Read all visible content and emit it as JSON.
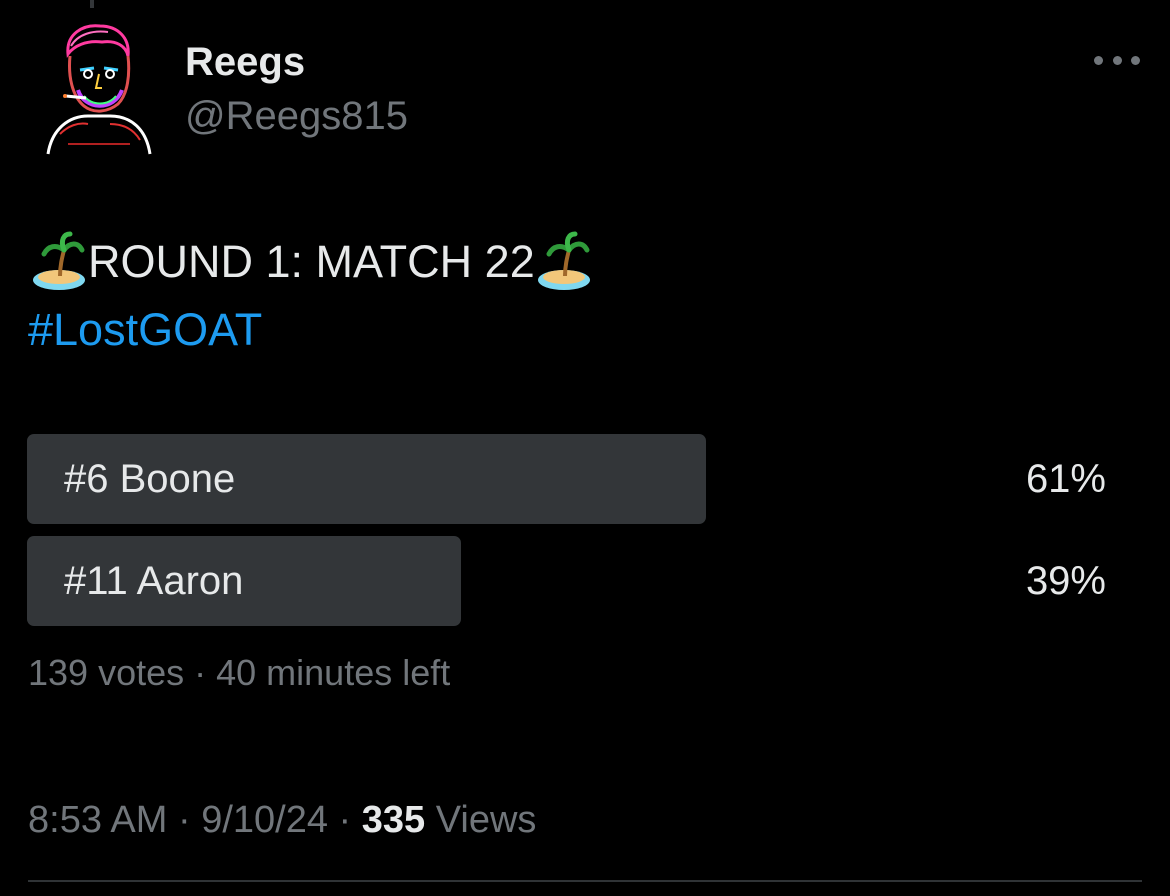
{
  "author": {
    "display_name": "Reegs",
    "handle": "@Reegs815",
    "avatar_icon": "neon-portrait-avatar"
  },
  "more_icon": "more-horizontal-icon",
  "tweet": {
    "title_text": "ROUND 1: MATCH 22",
    "leading_emoji": "desert-island-icon",
    "trailing_emoji": "desert-island-icon",
    "hashtag": "#LostGOAT"
  },
  "poll": {
    "options": [
      {
        "label": "#6 Boone",
        "percent_text": "61%",
        "fraction": 0.61
      },
      {
        "label": "#11 Aaron",
        "percent_text": "39%",
        "fraction": 0.39
      }
    ],
    "votes": "139 votes",
    "separator": " · ",
    "time_left": "40 minutes left"
  },
  "meta": {
    "time": "8:53 AM",
    "date": "9/10/24",
    "separator": " · ",
    "views_count": "335",
    "views_label": " Views"
  },
  "colors": {
    "background": "#000000",
    "primary_text": "#e7e9ea",
    "secondary_text": "#71767b",
    "link": "#1d9bf0",
    "poll_bar": "#333639"
  }
}
